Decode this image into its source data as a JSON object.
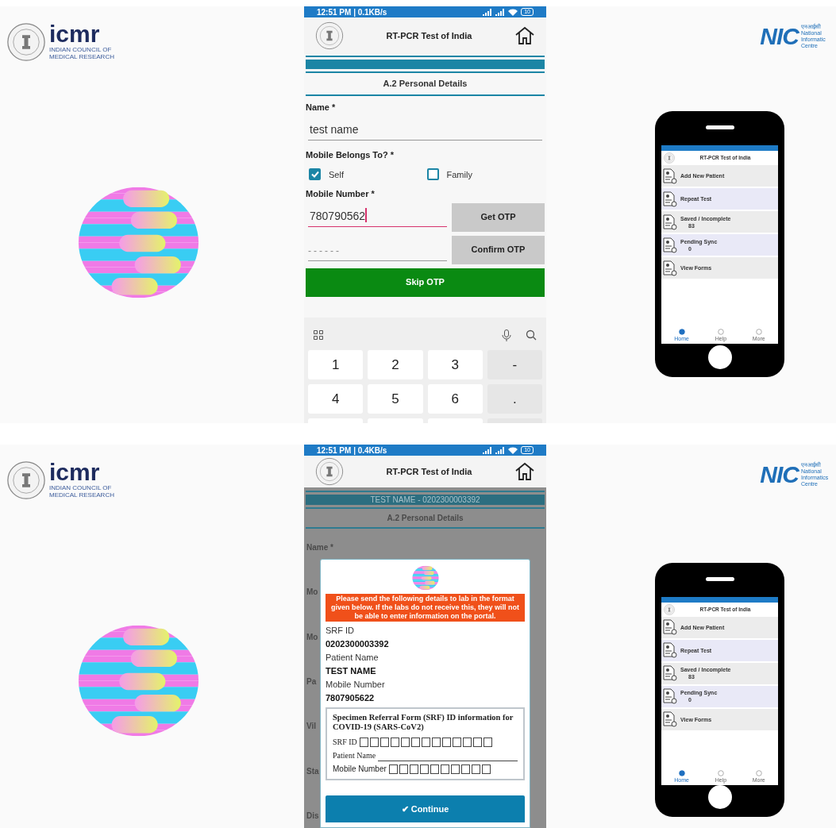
{
  "panels": [
    {
      "left_logo": {
        "wordmark": "icmr",
        "name_lines": [
          "INDIAN COUNCIL OF",
          "MEDICAL RESEARCH"
        ]
      },
      "screen": {
        "kind": "form",
        "status_bar": {
          "time": "12:51 PM | 0.1KB/s",
          "battery": "10"
        },
        "app_title": "RT-PCR Test of India",
        "section_title": "A.2 Personal Details",
        "name_label": "Name *",
        "name_value": "test name",
        "belongs_label": "Mobile Belongs To? *",
        "options": [
          {
            "label": "Self",
            "checked": true
          },
          {
            "label": "Family",
            "checked": false
          }
        ],
        "mobile_label": "Mobile Number *",
        "mobile_value": "780790562",
        "mobile_focused": true,
        "otp_placeholder": "------",
        "buttons": [
          {
            "label": "Get OTP",
            "kind": "gray"
          },
          {
            "label": "Confirm OTP",
            "kind": "gray"
          },
          {
            "label": "Skip OTP",
            "kind": "green"
          }
        ],
        "keys": [
          {
            "label": "1",
            "kind": "digit"
          },
          {
            "label": "2",
            "kind": "digit"
          },
          {
            "label": "3",
            "kind": "digit"
          },
          {
            "label": "-",
            "kind": "symbol"
          },
          {
            "label": "4",
            "kind": "digit"
          },
          {
            "label": "5",
            "kind": "digit"
          },
          {
            "label": "6",
            "kind": "digit"
          },
          {
            "label": ".",
            "kind": "symbol"
          }
        ]
      },
      "right_logo": {
        "wordmark": "NIC",
        "hindi": "एनआईसी",
        "name_lines": [
          "National",
          "Informatic",
          "Centre"
        ]
      },
      "phone": {
        "app_title": "RT-PCR Test of India",
        "menu": [
          {
            "label": "Add New Patient"
          },
          {
            "label": "Repeat Test"
          },
          {
            "label": "Saved / Incomplete",
            "count": "83"
          },
          {
            "label": "Pending Sync",
            "count": "0"
          },
          {
            "label": "View Forms"
          }
        ],
        "nav": [
          {
            "label": "Home",
            "selected": true
          },
          {
            "label": "Help",
            "selected": false
          },
          {
            "label": "More",
            "selected": false
          }
        ]
      }
    },
    {
      "left_logo": {
        "wordmark": "icmr",
        "name_lines": [
          "INDIAN COUNCIL OF",
          "MEDICAL RESEARCH"
        ]
      },
      "screen": {
        "kind": "dialog",
        "status_bar": {
          "time": "12:51 PM | 0.4KB/s",
          "battery": "10"
        },
        "app_title": "RT-PCR Test of India",
        "title_bar": "TEST NAME - 0202300003392",
        "section_title": "A.2 Personal Details",
        "fragments": [
          "Name *",
          "Mo",
          "Mo",
          "Pa",
          "Vil",
          "Sta",
          "Dis"
        ],
        "dialog": {
          "notice": "Please send the following details to lab in the format given below. If the labs do not receive this, they will not be able to enter information on the portal.",
          "fields": [
            {
              "label": "SRF ID",
              "value": "0202300003392"
            },
            {
              "label": "Patient Name",
              "value": "TEST NAME"
            },
            {
              "label": "Mobile Number",
              "value": "7807905622"
            }
          ],
          "form_image": {
            "title": "Specimen Referral Form (SRF) ID information for COVID-19 (SARS-CoV2)",
            "srf_label": "SRF ID",
            "name_label": "Patient Name",
            "mobile_label": "Mobile Number"
          },
          "button": "✔ Continue"
        }
      },
      "right_logo": {
        "wordmark": "NIC",
        "hindi": "एनआईसी",
        "name_lines": [
          "National",
          "Informatics",
          "Centre"
        ]
      },
      "phone": {
        "app_title": "RT-PCR Test of India",
        "menu": [
          {
            "label": "Add New Patient"
          },
          {
            "label": "Repeat Test"
          },
          {
            "label": "Saved / Incomplete",
            "count": "83"
          },
          {
            "label": "Pending Sync",
            "count": "0"
          },
          {
            "label": "View Forms"
          }
        ],
        "nav": [
          {
            "label": "Home",
            "selected": true
          },
          {
            "label": "Help",
            "selected": false
          },
          {
            "label": "More",
            "selected": false
          }
        ]
      }
    }
  ]
}
